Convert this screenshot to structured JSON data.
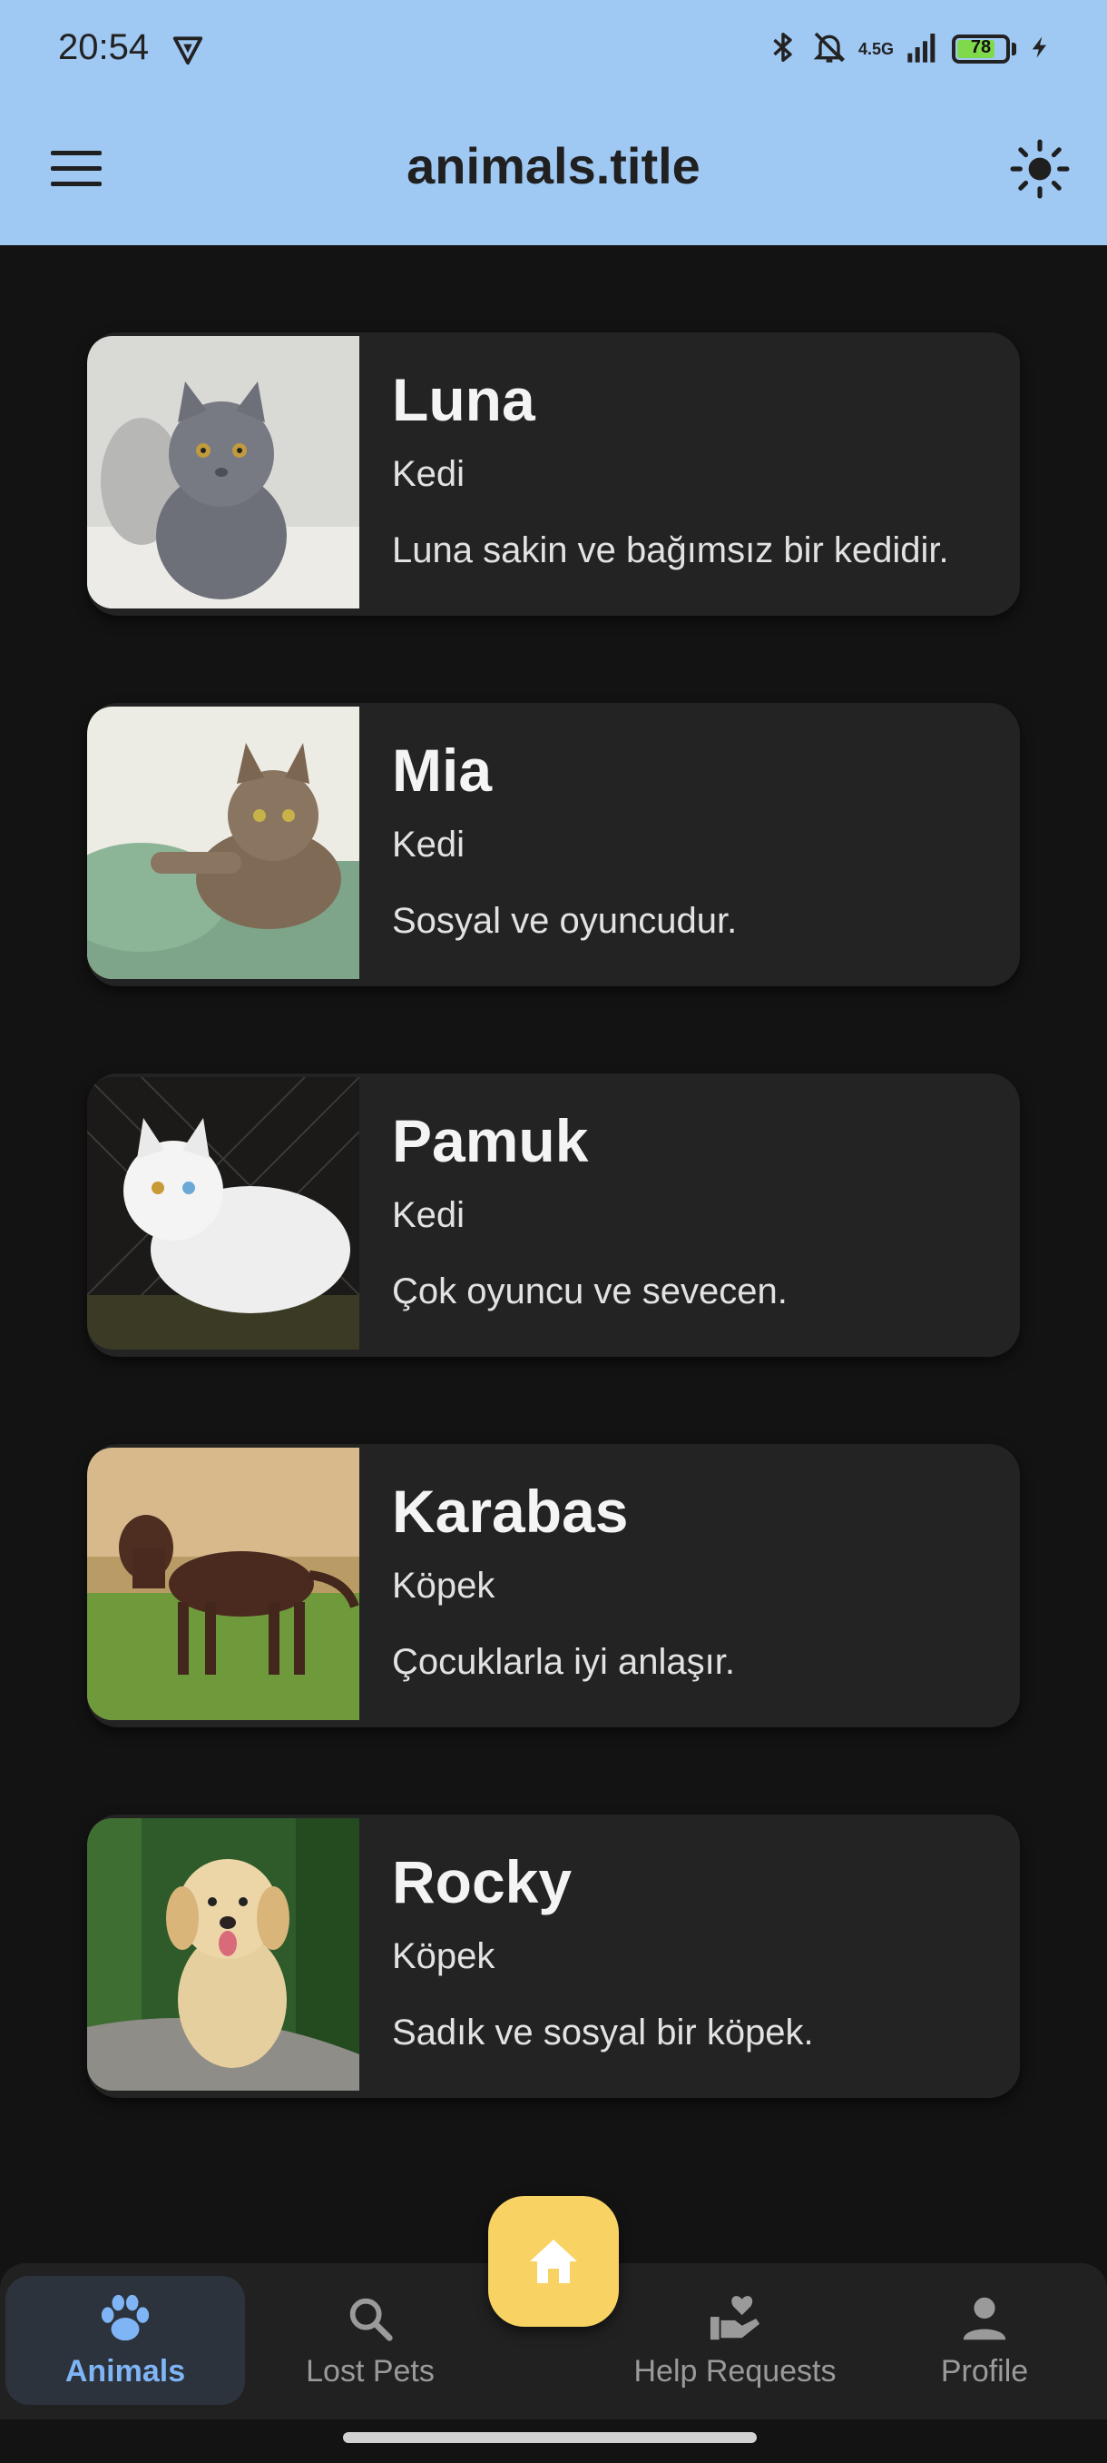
{
  "status_bar": {
    "time": "20:54",
    "network": "4.5G",
    "battery_percent": "78",
    "battery_level": 0.78,
    "icons": [
      "vpn-shield-icon",
      "bluetooth-icon",
      "bell-muted-icon",
      "signal-icon",
      "battery-icon",
      "charging-icon"
    ]
  },
  "app_bar": {
    "title": "animals.title",
    "menu_icon": "hamburger-menu-icon",
    "theme_icon": "sun-icon",
    "background_color": "#9fc8f3"
  },
  "animals": [
    {
      "name": "Luna",
      "type": "Kedi",
      "description": "Luna sakin ve bağımsız bir kedidir.",
      "photo": "gray kitten"
    },
    {
      "name": "Mia",
      "type": "Kedi",
      "description": "Sosyal ve oyuncudur.",
      "photo": "tabby kitten on pillow"
    },
    {
      "name": "Pamuk",
      "type": "Kedi",
      "description": "Çok oyuncu ve sevecen.",
      "photo": "white odd-eyed cat"
    },
    {
      "name": "Karabas",
      "type": "Köpek",
      "description": "Çocuklarla iyi anlaşır.",
      "photo": "brown labrador"
    },
    {
      "name": "Rocky",
      "type": "Köpek",
      "description": "Sadık ve sosyal bir köpek.",
      "photo": "golden retriever puppy"
    }
  ],
  "bottom_nav": {
    "items": [
      {
        "label": "Animals",
        "icon": "paw-icon",
        "active": true
      },
      {
        "label": "Lost Pets",
        "icon": "search-icon",
        "active": false
      },
      {
        "label": "Help Requests",
        "icon": "heart-hand-icon",
        "active": false
      },
      {
        "label": "Profile",
        "icon": "person-icon",
        "active": false
      }
    ],
    "fab_icon": "home-icon",
    "accent_color": "#7fb4f5",
    "fab_color": "#f8d263"
  }
}
